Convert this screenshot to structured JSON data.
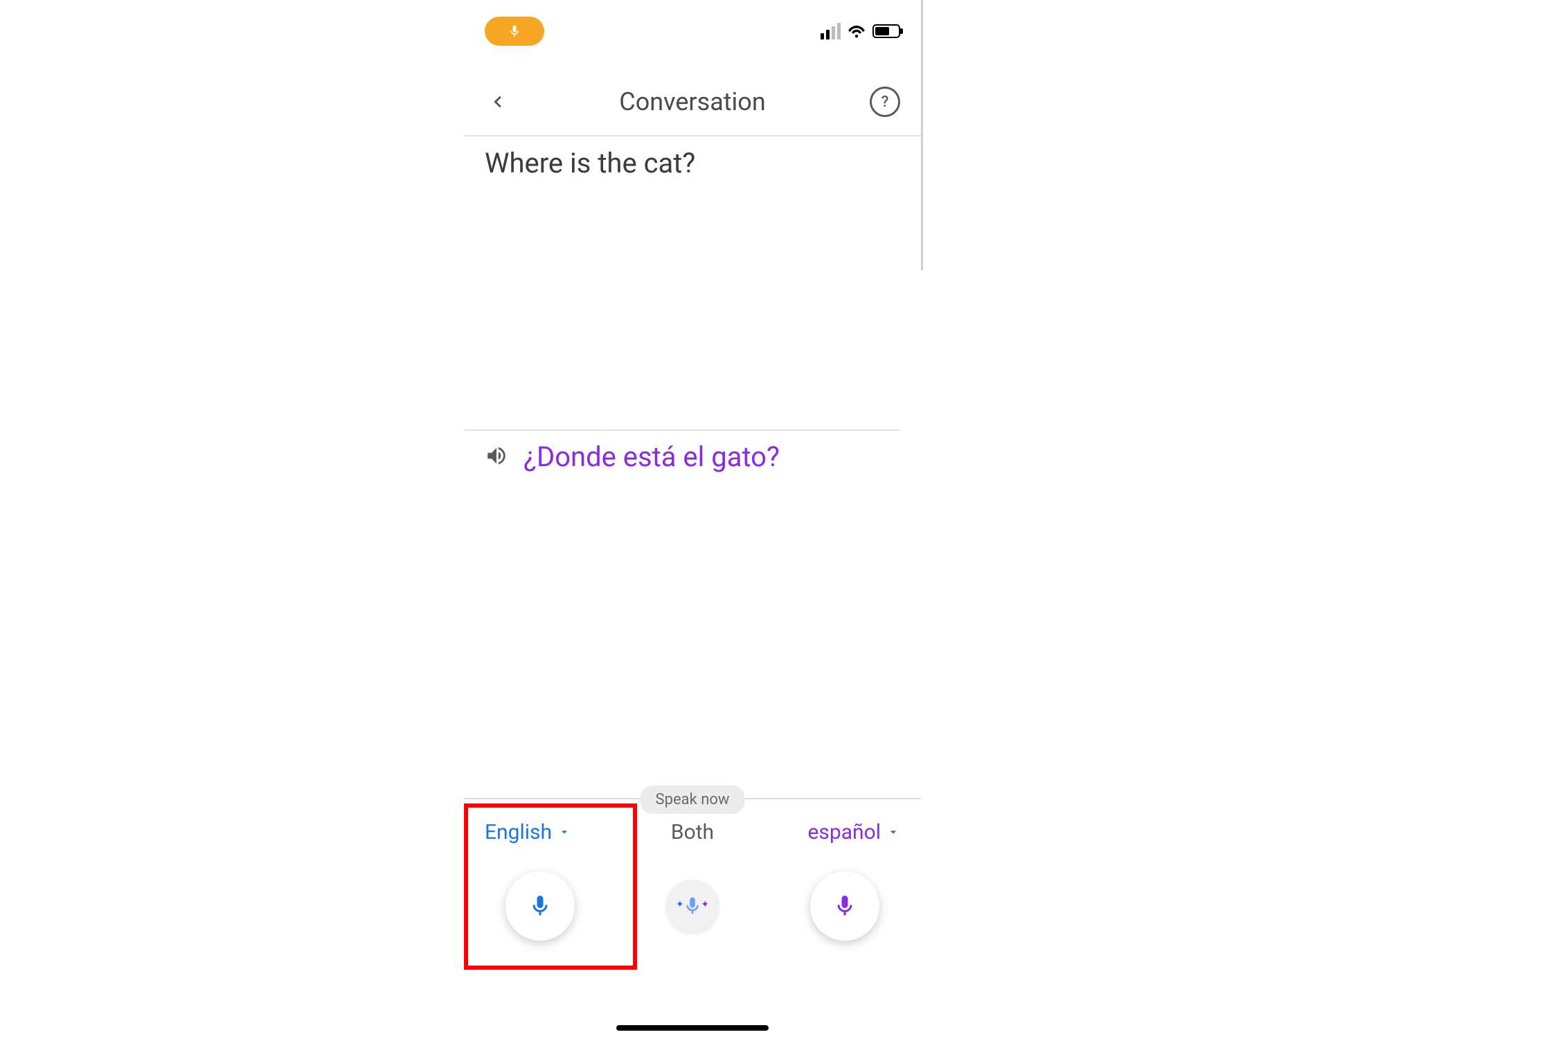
{
  "status": {
    "recording_icon": "microphone-icon"
  },
  "header": {
    "title": "Conversation"
  },
  "content": {
    "source_text": "Where is the cat?",
    "translated_text": "¿Donde está el gato?"
  },
  "footer": {
    "hint": "Speak now",
    "lang_left": "English",
    "lang_center": "Both",
    "lang_right": "español"
  },
  "colors": {
    "primary_blue": "#1a73e8",
    "primary_purple": "#8a2be2",
    "recording_orange": "#f5a623",
    "highlight_red": "#ff0000"
  }
}
